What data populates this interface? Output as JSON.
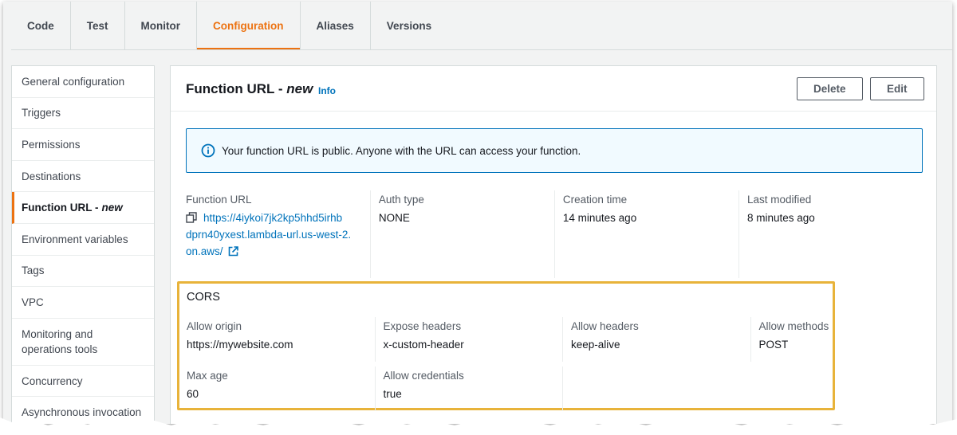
{
  "tabs": [
    {
      "label": "Code"
    },
    {
      "label": "Test"
    },
    {
      "label": "Monitor"
    },
    {
      "label": "Configuration",
      "active": true
    },
    {
      "label": "Aliases"
    },
    {
      "label": "Versions"
    }
  ],
  "sidebar": {
    "items": [
      {
        "label": "General configuration"
      },
      {
        "label": "Triggers"
      },
      {
        "label": "Permissions"
      },
      {
        "label": "Destinations"
      },
      {
        "label": "Function URL -",
        "suffix": "new",
        "active": true
      },
      {
        "label": "Environment variables"
      },
      {
        "label": "Tags"
      },
      {
        "label": "VPC"
      },
      {
        "label": "Monitoring and operations tools"
      },
      {
        "label": "Concurrency"
      },
      {
        "label": "Asynchronous invocation"
      }
    ]
  },
  "panel": {
    "title": "Function URL -",
    "title_suffix": "new",
    "info": "Info",
    "delete_label": "Delete",
    "edit_label": "Edit",
    "alert_text": "Your function URL is public. Anyone with the URL can access your function.",
    "fields": {
      "function_url_label": "Function URL",
      "function_url_lines": [
        "https://4iykoi7jk2kp5hhd5irhb",
        "dprn40yxest.lambda-url.us-west-2.",
        "on.aws/"
      ],
      "auth_type_label": "Auth type",
      "auth_type_value": "NONE",
      "creation_time_label": "Creation time",
      "creation_time_value": "14 minutes ago",
      "last_modified_label": "Last modified",
      "last_modified_value": "8 minutes ago"
    },
    "cors": {
      "title": "CORS",
      "allow_origin_label": "Allow origin",
      "allow_origin_value": "https://mywebsite.com",
      "expose_headers_label": "Expose headers",
      "expose_headers_value": "x-custom-header",
      "allow_headers_label": "Allow headers",
      "allow_headers_value": "keep-alive",
      "allow_methods_label": "Allow methods",
      "allow_methods_value": "POST",
      "max_age_label": "Max age",
      "max_age_value": "60",
      "allow_credentials_label": "Allow credentials",
      "allow_credentials_value": "true"
    }
  },
  "colors": {
    "accent": "#ec7211",
    "link": "#0073bb",
    "highlight": "#e8b33a",
    "alert_bg": "#f1faff"
  }
}
